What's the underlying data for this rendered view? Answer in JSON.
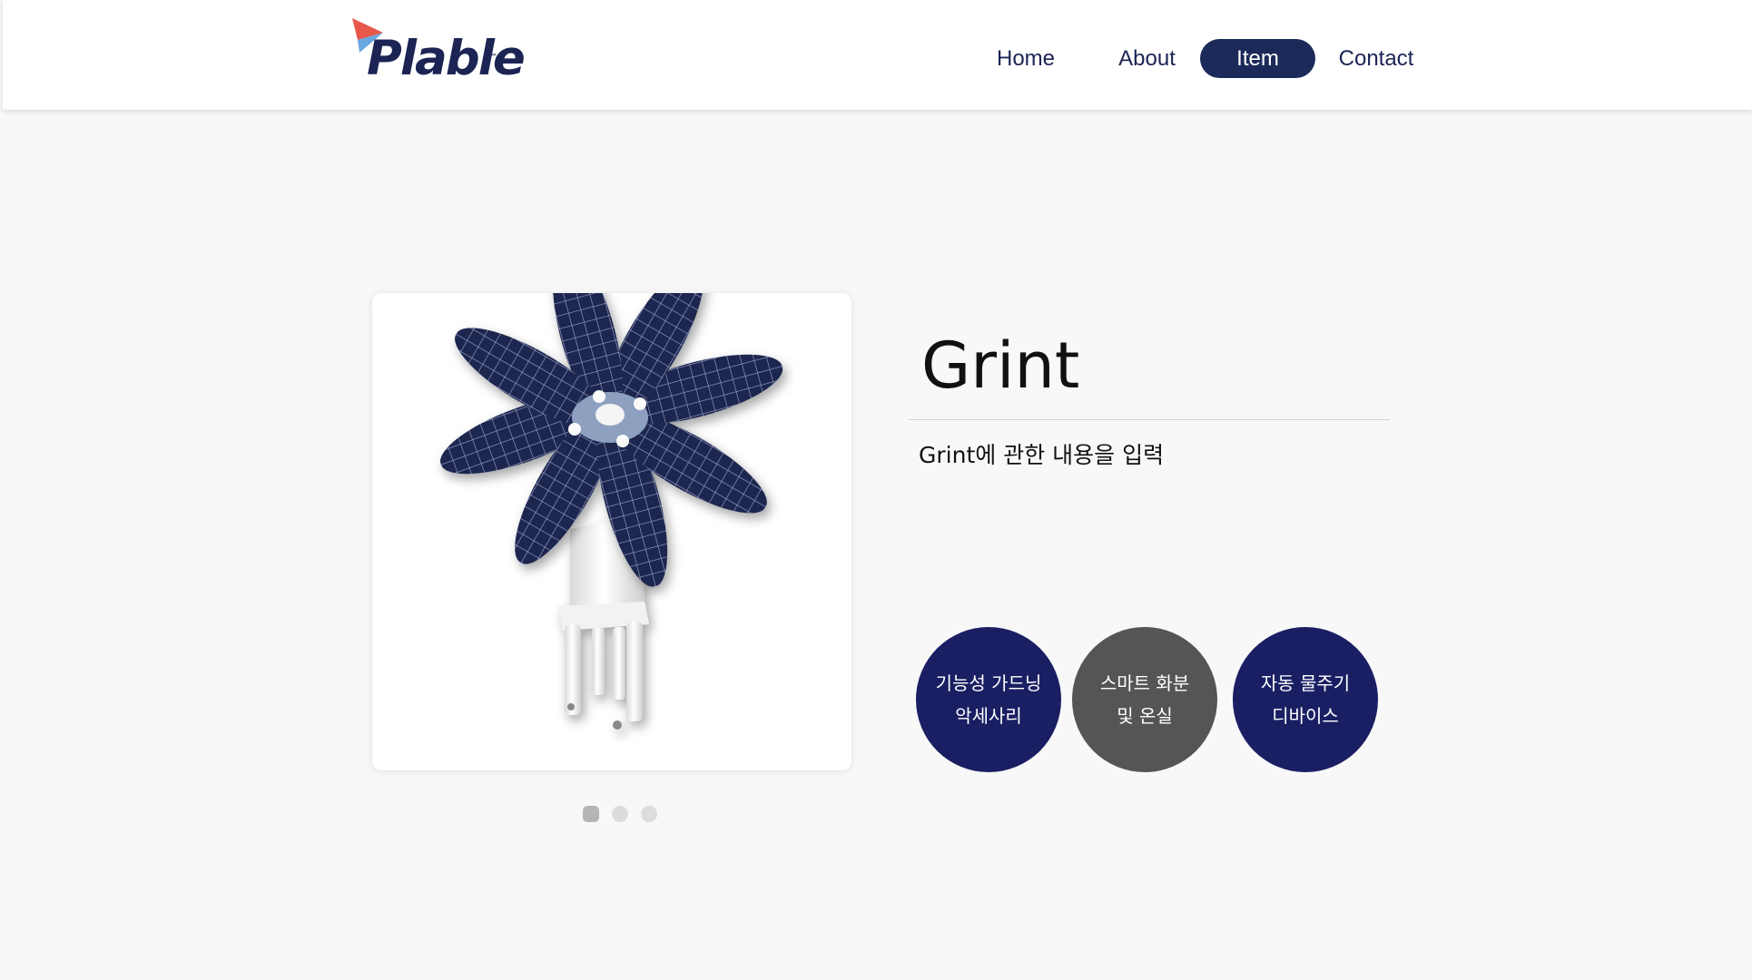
{
  "brand": {
    "name": "Plable",
    "trademark": "™",
    "colors": {
      "navy": "#1c2454",
      "red": "#e8584a",
      "blue": "#6aa6e0"
    }
  },
  "nav": {
    "items": [
      {
        "label": "Home",
        "active": false
      },
      {
        "label": "About",
        "active": false
      },
      {
        "label": "Item",
        "active": true
      },
      {
        "label": "Contact",
        "active": false
      }
    ]
  },
  "product": {
    "title": "Grint",
    "description": "Grint에 관한 내용을 입력",
    "image_icon": "solar-flower-device-image",
    "carousel": {
      "count": 3,
      "active_index": 1
    },
    "tags": [
      {
        "line1": "기능성 가드닝",
        "line2": "악세사리",
        "color": "#1a1f63"
      },
      {
        "line1": "스마트 화분",
        "line2": "및 온실",
        "color": "#555555"
      },
      {
        "line1": "자동 물주기",
        "line2": "디바이스",
        "color": "#1a1f63"
      }
    ]
  }
}
